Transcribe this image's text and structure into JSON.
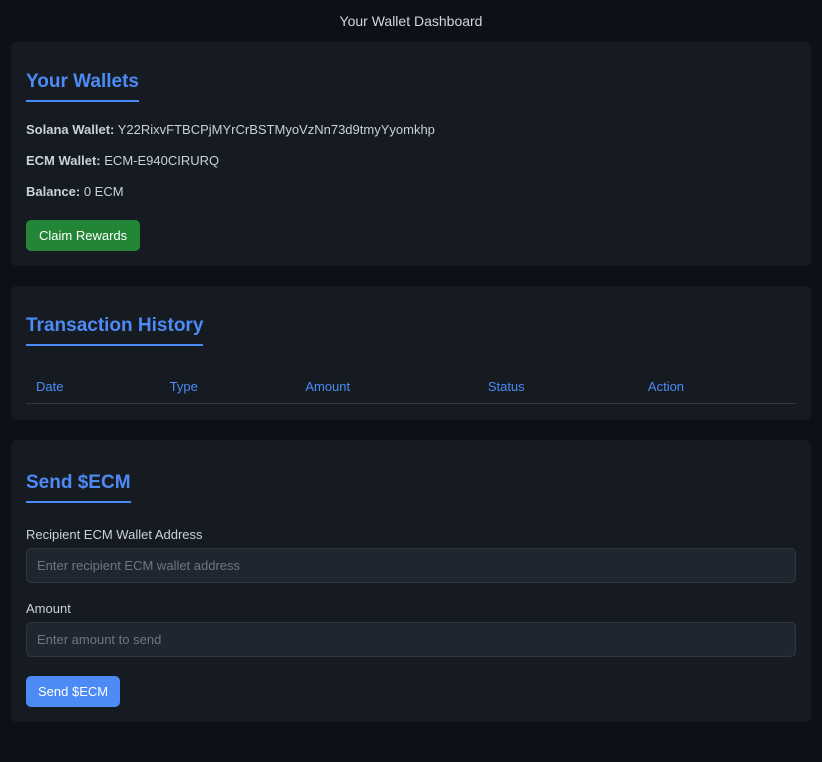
{
  "pageTitle": "Your Wallet Dashboard",
  "wallets": {
    "title": "Your Wallets",
    "solanaLabel": "Solana Wallet:",
    "solanaValue": "Y22RixvFTBCPjMYrCrBSTMyoVzNn73d9tmyYyomkhp",
    "ecmLabel": "ECM Wallet:",
    "ecmValue": "ECM-E940CIRURQ",
    "balanceLabel": "Balance:",
    "balanceValue": "0 ECM",
    "claimButton": "Claim Rewards"
  },
  "transactions": {
    "title": "Transaction History",
    "columns": {
      "date": "Date",
      "type": "Type",
      "amount": "Amount",
      "status": "Status",
      "action": "Action"
    }
  },
  "send": {
    "title": "Send $ECM",
    "recipientLabel": "Recipient ECM Wallet Address",
    "recipientPlaceholder": "Enter recipient ECM wallet address",
    "amountLabel": "Amount",
    "amountPlaceholder": "Enter amount to send",
    "sendButton": "Send $ECM"
  }
}
